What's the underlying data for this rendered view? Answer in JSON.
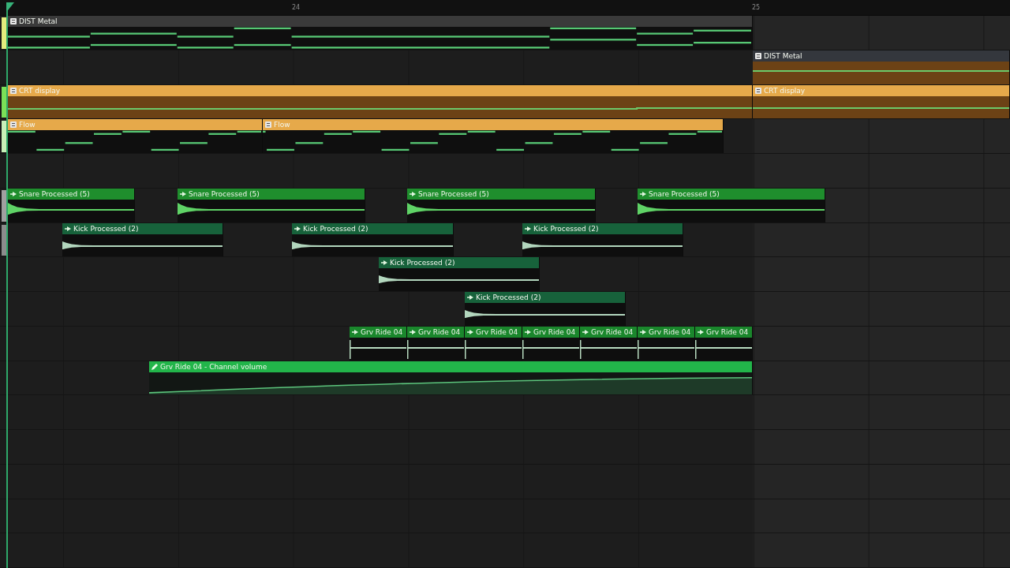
{
  "ruler": {
    "bar_numbers": [
      "24",
      "25"
    ]
  },
  "tracks": [
    {
      "color": "#e3ec7e",
      "clips": [
        {
          "name": "DIST Metal",
          "kind": "pattern",
          "color": "#3a3a3a"
        }
      ]
    },
    {
      "clips": [
        {
          "name": "DIST Metal",
          "kind": "envelope",
          "color": "#34373d"
        }
      ]
    },
    {
      "color": "#7be057",
      "clips": [
        {
          "name": "CRT display",
          "kind": "envelope",
          "color": "#e6a94a"
        },
        {
          "name": "CRT display",
          "kind": "envelope",
          "color": "#e6a94a"
        }
      ]
    },
    {
      "color": "#c9f0b8",
      "clips": [
        {
          "name": "Flow",
          "kind": "pattern",
          "color": "#e6a94a"
        },
        {
          "name": "Flow",
          "kind": "pattern",
          "color": "#e6a94a"
        }
      ]
    },
    {
      "color": "#a0a0a0",
      "clips": [
        {
          "name": "Snare Processed (5)",
          "kind": "audio",
          "color": "#1f8e2d"
        },
        {
          "name": "Snare Processed (5)",
          "kind": "audio",
          "color": "#1f8e2d"
        },
        {
          "name": "Snare Processed (5)",
          "kind": "audio",
          "color": "#1f8e2d"
        },
        {
          "name": "Snare Processed (5)",
          "kind": "audio",
          "color": "#1f8e2d"
        }
      ]
    },
    {
      "color": "#8c8c8c",
      "clips": [
        {
          "name": "Kick Processed (2)",
          "kind": "audio",
          "color": "#17623b"
        },
        {
          "name": "Kick Processed (2)",
          "kind": "audio",
          "color": "#17623b"
        },
        {
          "name": "Kick Processed (2)",
          "kind": "audio",
          "color": "#17623b"
        }
      ]
    },
    {
      "clips": [
        {
          "name": "Kick Processed (2)",
          "kind": "audio",
          "color": "#17623b"
        }
      ]
    },
    {
      "clips": [
        {
          "name": "Kick Processed (2)",
          "kind": "audio",
          "color": "#17623b"
        }
      ]
    },
    {
      "clips": [
        {
          "name": "Grv Ride 04",
          "kind": "audio",
          "color": "#1a872c"
        },
        {
          "name": "Grv Ride 04",
          "kind": "audio",
          "color": "#1a872c"
        },
        {
          "name": "Grv Ride 04",
          "kind": "audio",
          "color": "#1a872c"
        },
        {
          "name": "Grv Ride 04",
          "kind": "audio",
          "color": "#1a872c"
        },
        {
          "name": "Grv Ride 04",
          "kind": "audio",
          "color": "#1a872c"
        },
        {
          "name": "Grv Ride 04",
          "kind": "audio",
          "color": "#1a872c"
        },
        {
          "name": "Grv Ride 04",
          "kind": "audio",
          "color": "#1a872c"
        }
      ]
    },
    {
      "clips": [
        {
          "name": "Grv Ride 04 - Channel volume",
          "kind": "automation",
          "color": "#22b54a"
        }
      ]
    }
  ]
}
